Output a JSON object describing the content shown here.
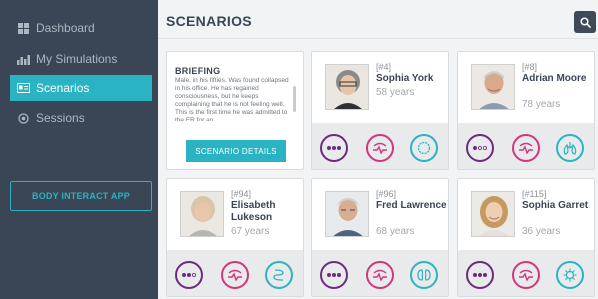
{
  "sidebar": {
    "items": [
      {
        "label": "Dashboard",
        "icon": "grid-icon"
      },
      {
        "label": "My Simulations",
        "icon": "bar-chart-icon"
      },
      {
        "label": "Scenarios",
        "icon": "id-card-icon",
        "active": true
      },
      {
        "label": "Sessions",
        "icon": "target-icon"
      }
    ],
    "app_button": "BODY INTERACT APP"
  },
  "header": {
    "title": "SCENARIOS",
    "search_icon": "search-icon"
  },
  "briefing": {
    "title": "BRIEFING",
    "text": "Male, in his fifties. Was found collapsed in his office. He has regained consciousness, but he keeps complaining that he is not feeling well. This is the first time he was admitted to the ER for an",
    "button": "SCENARIO DETAILS"
  },
  "scenarios": [
    {
      "id": "[#4]",
      "name": "Sophia York",
      "age": "58 years",
      "icons": [
        "dots-icon",
        "ecg-icon",
        "neuro-icon"
      ]
    },
    {
      "id": "[#8]",
      "name": "Adrian Moore",
      "age": "78 years",
      "icons": [
        "dots-icon",
        "ecg-icon",
        "lungs-icon"
      ]
    },
    {
      "id": "[#94]",
      "name": "Elisabeth Lukeson",
      "age": "67 years",
      "icons": [
        "dots-icon",
        "ecg-icon",
        "digestive-icon"
      ]
    },
    {
      "id": "[#96]",
      "name": "Fred Lawrence",
      "age": "68 years",
      "icons": [
        "dots-icon",
        "ecg-icon",
        "kidney-icon"
      ]
    },
    {
      "id": "[#115]",
      "name": "Sophia Garret",
      "age": "36 years",
      "icons": [
        "dots-icon",
        "ecg-icon",
        "infection-icon"
      ]
    }
  ],
  "colors": {
    "sidebar_bg": "#3a4555",
    "accent": "#2ab3c2",
    "level_purple": "#6c2b7f",
    "cardio_pink": "#d2367e"
  }
}
